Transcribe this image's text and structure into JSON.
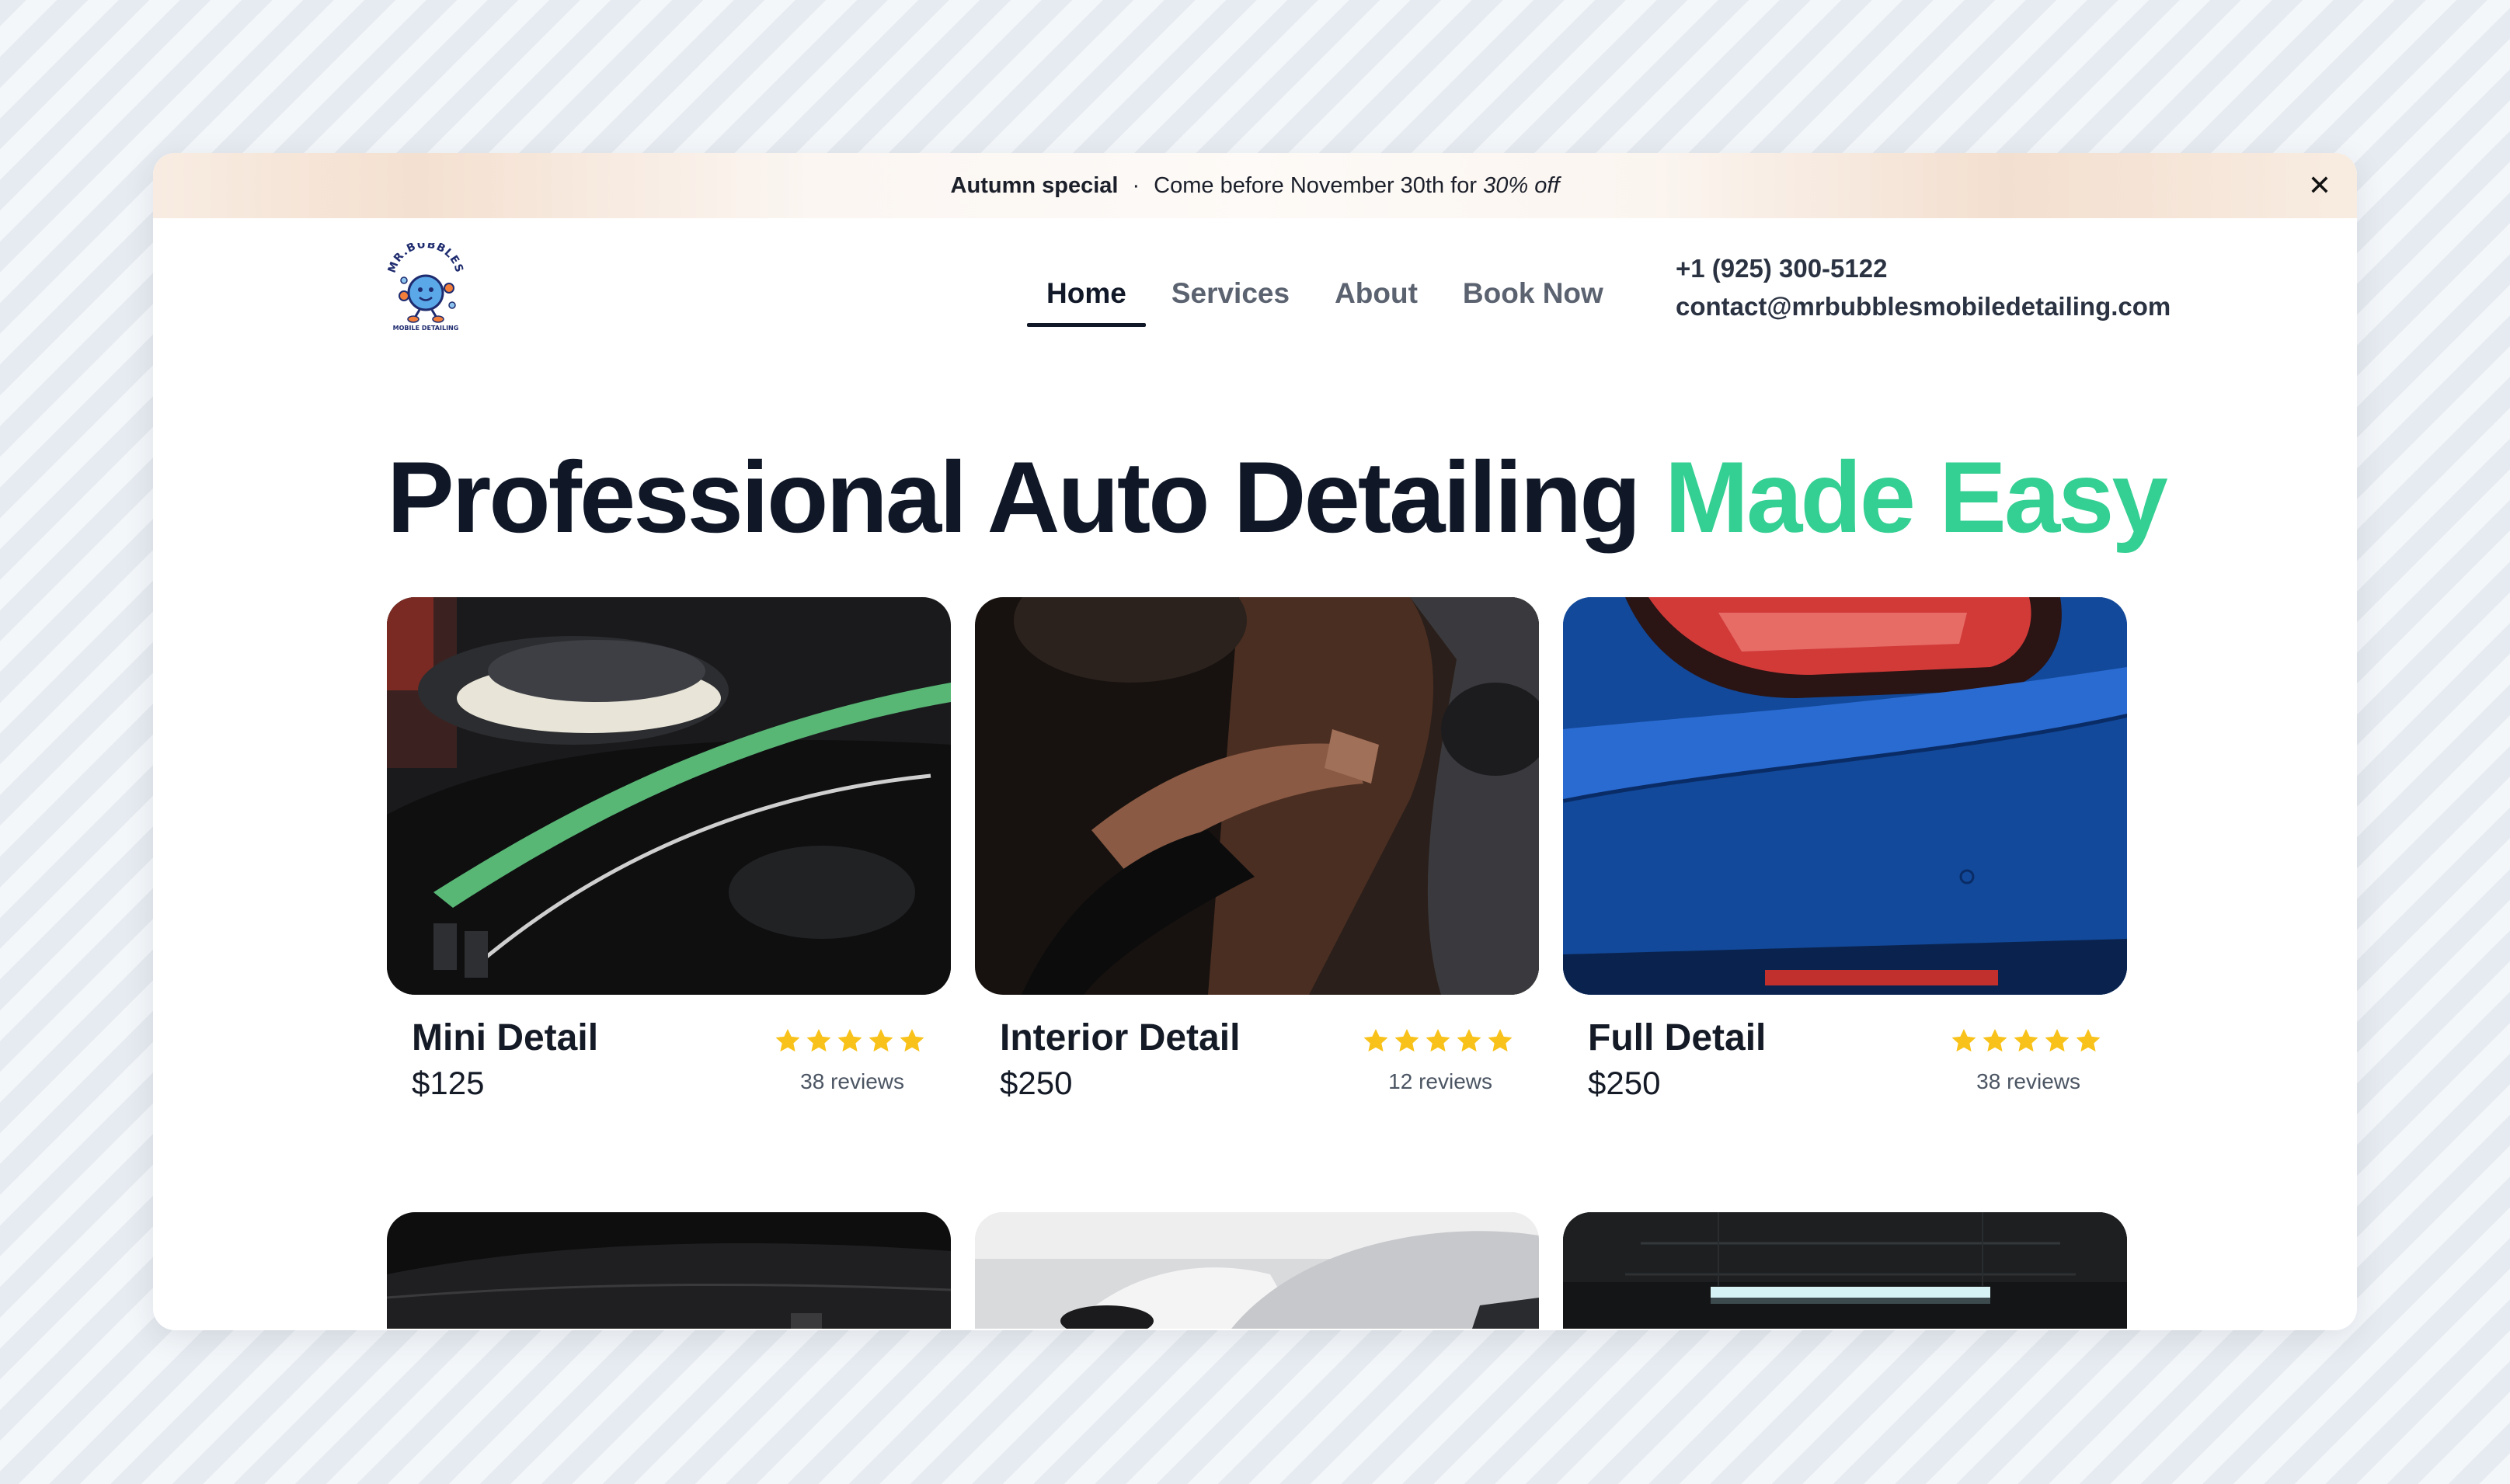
{
  "promo": {
    "highlight": "Autumn special",
    "separator": "·",
    "text": "Come before November 30th for",
    "discount": "30% off",
    "close_label": "✕"
  },
  "logo": {
    "top_text": "MR.BUBBLES",
    "bottom_text": "MOBILE DETAILING"
  },
  "nav": {
    "items": [
      {
        "label": "Home",
        "active": true
      },
      {
        "label": "Services"
      },
      {
        "label": "About"
      },
      {
        "label": "Book Now"
      }
    ]
  },
  "contact": {
    "phone": "+1 (925) 300-5122",
    "email": "contact@mrbubblesmobiledetailing.com"
  },
  "hero": {
    "title_main": "Professional Auto Detailing",
    "title_accent": "Made Easy"
  },
  "colors": {
    "accent": "#34cf92",
    "star": "#f8c21a",
    "text_dark": "#101828"
  },
  "services": [
    {
      "title": "Mini Detail",
      "price": "$125",
      "rating": 5,
      "reviews": "38 reviews",
      "image": "polisher-on-black-car"
    },
    {
      "title": "Interior Detail",
      "price": "$250",
      "rating": 5,
      "reviews": "12 reviews",
      "image": "interior-cleaning"
    },
    {
      "title": "Full Detail",
      "price": "$250",
      "rating": 5,
      "reviews": "38 reviews",
      "image": "blue-car-taillight"
    }
  ],
  "more_services_images": [
    "dark-car-hood",
    "white-car-garage",
    "garage-ceiling-light"
  ]
}
